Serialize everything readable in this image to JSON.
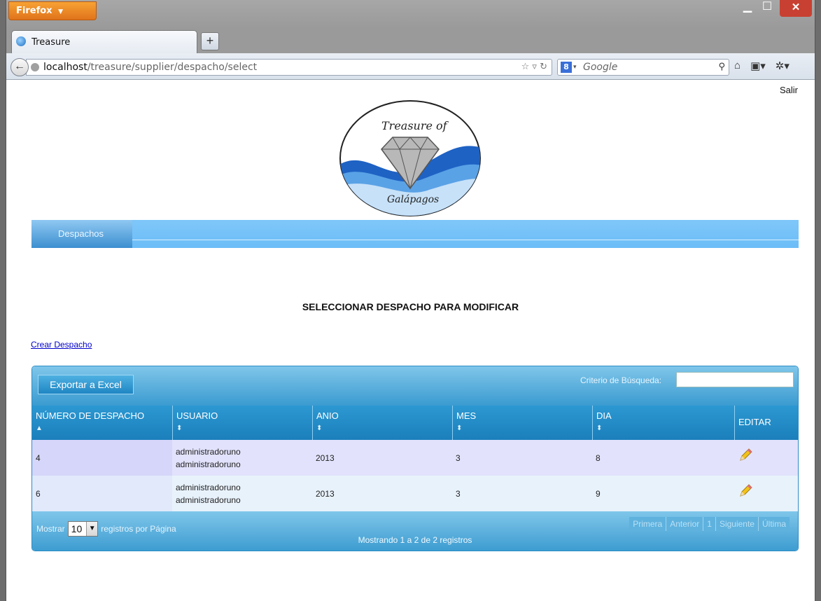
{
  "browser": {
    "app_button": "Firefox",
    "tab_title": "Treasure",
    "url_host": "localhost",
    "url_path": "/treasure/supplier/despacho/select",
    "search_placeholder": "Google"
  },
  "page": {
    "logout_link": "Salir",
    "logo_text_top": "Treasure of",
    "logo_text_bottom": "Galápagos",
    "menu": {
      "item_despachos": "Despachos"
    },
    "heading": "SELECCIONAR DESPACHO PARA MODIFICAR",
    "create_link": "Crear Despacho"
  },
  "table": {
    "export_button": "Exportar a Excel",
    "search_label": "Criterio de Búsqueda:",
    "search_value": "",
    "columns": [
      "NÚMERO DE DESPACHO",
      "USUARIO",
      "ANIO",
      "MES",
      "DIA",
      "EDITAR"
    ],
    "rows": [
      {
        "numero": "4",
        "usuario_1": "administradoruno",
        "usuario_2": "administradoruno",
        "anio": "2013",
        "mes": "3",
        "dia": "8"
      },
      {
        "numero": "6",
        "usuario_1": "administradoruno",
        "usuario_2": "administradoruno",
        "anio": "2013",
        "mes": "3",
        "dia": "9"
      }
    ],
    "footer": {
      "show_prefix": "Mostrar",
      "page_size": "10",
      "show_suffix": "registros por Página",
      "info": "Mostrando 1 a 2 de 2 registros",
      "pager": {
        "first": "Primera",
        "prev": "Anterior",
        "current": "1",
        "next": "Siguiente",
        "last": "Última"
      }
    }
  },
  "colors": {
    "menu_bar": "#74c1f8",
    "grid_header": "#2390c9",
    "row_odd": "#e2e2fc",
    "row_even": "#e8f2fb",
    "firefox_orange": "#e8841f"
  }
}
